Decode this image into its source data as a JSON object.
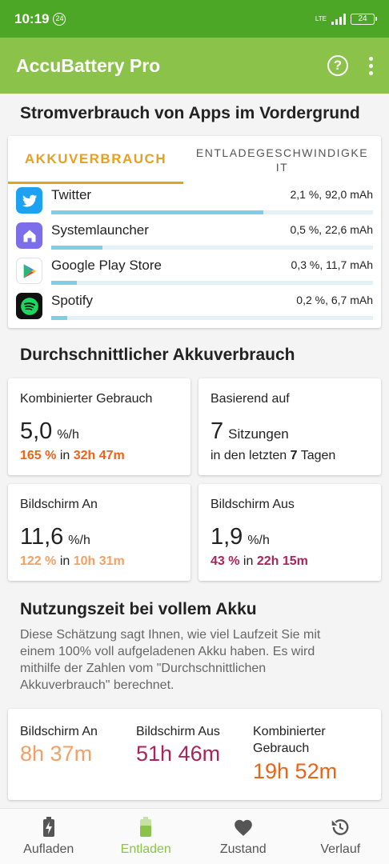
{
  "status_bar": {
    "time": "10:19",
    "notification_badge": "24",
    "network": "LTE",
    "battery": "24"
  },
  "app_bar": {
    "title": "AccuBattery Pro",
    "help_icon": "help-circle-icon",
    "menu_icon": "more-vert-icon"
  },
  "foreground": {
    "heading": "Stromverbrauch von Apps im Vordergrund",
    "tabs": [
      {
        "label": "AKKUVERBRAUCH"
      },
      {
        "label": "ENTLADEGESCHWINDIGKEIT"
      }
    ],
    "apps": [
      {
        "name": "Twitter",
        "value": "2,1 %, 92,0 mAh",
        "fraction": 0.66,
        "icon": "twitter-icon"
      },
      {
        "name": "Systemlauncher",
        "value": "0,5 %, 22,6 mAh",
        "fraction": 0.16,
        "icon": "home-launcher-icon"
      },
      {
        "name": "Google Play Store",
        "value": "0,3 %, 11,7 mAh",
        "fraction": 0.08,
        "icon": "play-store-icon"
      },
      {
        "name": "Spotify",
        "value": "0,2 %, 6,7 mAh",
        "fraction": 0.05,
        "icon": "spotify-icon"
      }
    ]
  },
  "average": {
    "heading": "Durchschnittlicher Akkuverbrauch",
    "combined": {
      "title": "Kombinierter Gebrauch",
      "value": "5,0",
      "unit": "%/h",
      "pct": "165 %",
      "in": "in",
      "time": "32h 47m"
    },
    "based_on": {
      "title": "Basierend auf",
      "count": "7",
      "sessions": "Sitzungen",
      "prefix": "in den letzten",
      "days": "7",
      "suffix": "Tagen"
    },
    "screen_on": {
      "title": "Bildschirm An",
      "value": "11,6",
      "unit": "%/h",
      "pct": "122 %",
      "in": "in",
      "time": "10h 31m"
    },
    "screen_off": {
      "title": "Bildschirm Aus",
      "value": "1,9",
      "unit": "%/h",
      "pct": "43 %",
      "in": "in",
      "time": "22h 15m"
    }
  },
  "full_charge": {
    "heading": "Nutzungszeit bei vollem Akku",
    "description": "Diese Schätzung sagt Ihnen, wie viel Laufzeit Sie mit einem 100% voll aufgeladenen Akku haben. Es wird mithilfe der Zahlen vom \"Durchschnittlichen Akkuverbrauch\" berechnet.",
    "screen_on": {
      "label": "Bildschirm An",
      "value": "8h 37m"
    },
    "screen_off": {
      "label": "Bildschirm Aus",
      "value": "51h 46m"
    },
    "combined": {
      "label": "Kombinierter Gebrauch",
      "value": "19h 52m"
    }
  },
  "colors": {
    "status_bar": "#4ca727",
    "app_bar": "#8bc34a",
    "tab_active": "#e6a123",
    "bar_fill": "#7fcde8",
    "combined": "#e8651a",
    "screen_on": "#f1a067",
    "screen_off": "#a8245b"
  },
  "bottom_nav": [
    {
      "label": "Aufladen",
      "icon": "battery-charging-icon"
    },
    {
      "label": "Entladen",
      "icon": "battery-icon",
      "active": true
    },
    {
      "label": "Zustand",
      "icon": "heart-icon"
    },
    {
      "label": "Verlauf",
      "icon": "history-icon"
    }
  ]
}
